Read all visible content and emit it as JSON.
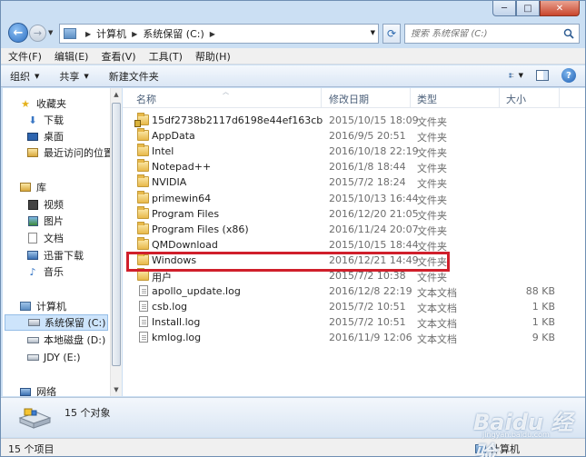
{
  "window": {
    "controls": {
      "minimize": "─",
      "maximize": "□",
      "close": "✕"
    }
  },
  "address": {
    "crumbs": [
      "计算机",
      "系统保留 (C:)"
    ],
    "search_placeholder": "搜索 系统保留 (C:)"
  },
  "menu": [
    "文件(F)",
    "编辑(E)",
    "查看(V)",
    "工具(T)",
    "帮助(H)"
  ],
  "commands": {
    "organize": "组织",
    "share": "共享",
    "new_folder": "新建文件夹",
    "help": "?"
  },
  "nav": {
    "favorites": "收藏夹",
    "downloads": "下载",
    "desktop": "桌面",
    "recent": "最近访问的位置",
    "libraries": "库",
    "videos": "视频",
    "pictures": "图片",
    "documents": "文档",
    "thunder": "迅雷下载",
    "music": "音乐",
    "computer": "计算机",
    "drive_c": "系统保留 (C:)",
    "drive_d": "本地磁盘 (D:)",
    "drive_e": "JDY (E:)",
    "network": "网络"
  },
  "columns": {
    "name": "名称",
    "date": "修改日期",
    "type": "类型",
    "size": "大小"
  },
  "files": [
    {
      "name": "15df2738b2117d6198e44ef163cb",
      "date": "2015/10/15 18:09",
      "type": "文件夹",
      "size": "",
      "icon": "locked-folder-icon"
    },
    {
      "name": "AppData",
      "date": "2016/9/5 20:51",
      "type": "文件夹",
      "size": "",
      "icon": "folder-icon"
    },
    {
      "name": "Intel",
      "date": "2016/10/18 22:19",
      "type": "文件夹",
      "size": "",
      "icon": "folder-icon"
    },
    {
      "name": "Notepad++",
      "date": "2016/1/8 18:44",
      "type": "文件夹",
      "size": "",
      "icon": "folder-icon"
    },
    {
      "name": "NVIDIA",
      "date": "2015/7/2 18:24",
      "type": "文件夹",
      "size": "",
      "icon": "folder-icon"
    },
    {
      "name": "primewin64",
      "date": "2015/10/13 16:44",
      "type": "文件夹",
      "size": "",
      "icon": "folder-icon"
    },
    {
      "name": "Program Files",
      "date": "2016/12/20 21:05",
      "type": "文件夹",
      "size": "",
      "icon": "folder-icon"
    },
    {
      "name": "Program Files (x86)",
      "date": "2016/11/24 20:07",
      "type": "文件夹",
      "size": "",
      "icon": "folder-icon"
    },
    {
      "name": "QMDownload",
      "date": "2015/10/15 18:44",
      "type": "文件夹",
      "size": "",
      "icon": "folder-icon"
    },
    {
      "name": "Windows",
      "date": "2016/12/21 14:49",
      "type": "文件夹",
      "size": "",
      "icon": "folder-icon"
    },
    {
      "name": "用户",
      "date": "2015/7/2 10:38",
      "type": "文件夹",
      "size": "",
      "icon": "folder-icon"
    },
    {
      "name": "apollo_update.log",
      "date": "2016/12/8 22:19",
      "type": "文本文档",
      "size": "88 KB",
      "icon": "document-icon"
    },
    {
      "name": "csb.log",
      "date": "2015/7/2 10:51",
      "type": "文本文档",
      "size": "1 KB",
      "icon": "document-icon"
    },
    {
      "name": "Install.log",
      "date": "2015/7/2 10:51",
      "type": "文本文档",
      "size": "1 KB",
      "icon": "document-icon"
    },
    {
      "name": "kmlog.log",
      "date": "2016/11/9 12:06",
      "type": "文本文档",
      "size": "9 KB",
      "icon": "document-icon"
    }
  ],
  "highlighted_item": "Windows",
  "details": {
    "count_text": "15 个对象"
  },
  "status": {
    "left": "15 个项目",
    "right": "计算机"
  },
  "watermark": {
    "main": "Baidu 经验",
    "sub": "jingyan.baidu.com"
  },
  "colors": {
    "highlight": "#d01f2b",
    "selection": "#cde4fb",
    "accent": "#2d6fc2"
  }
}
